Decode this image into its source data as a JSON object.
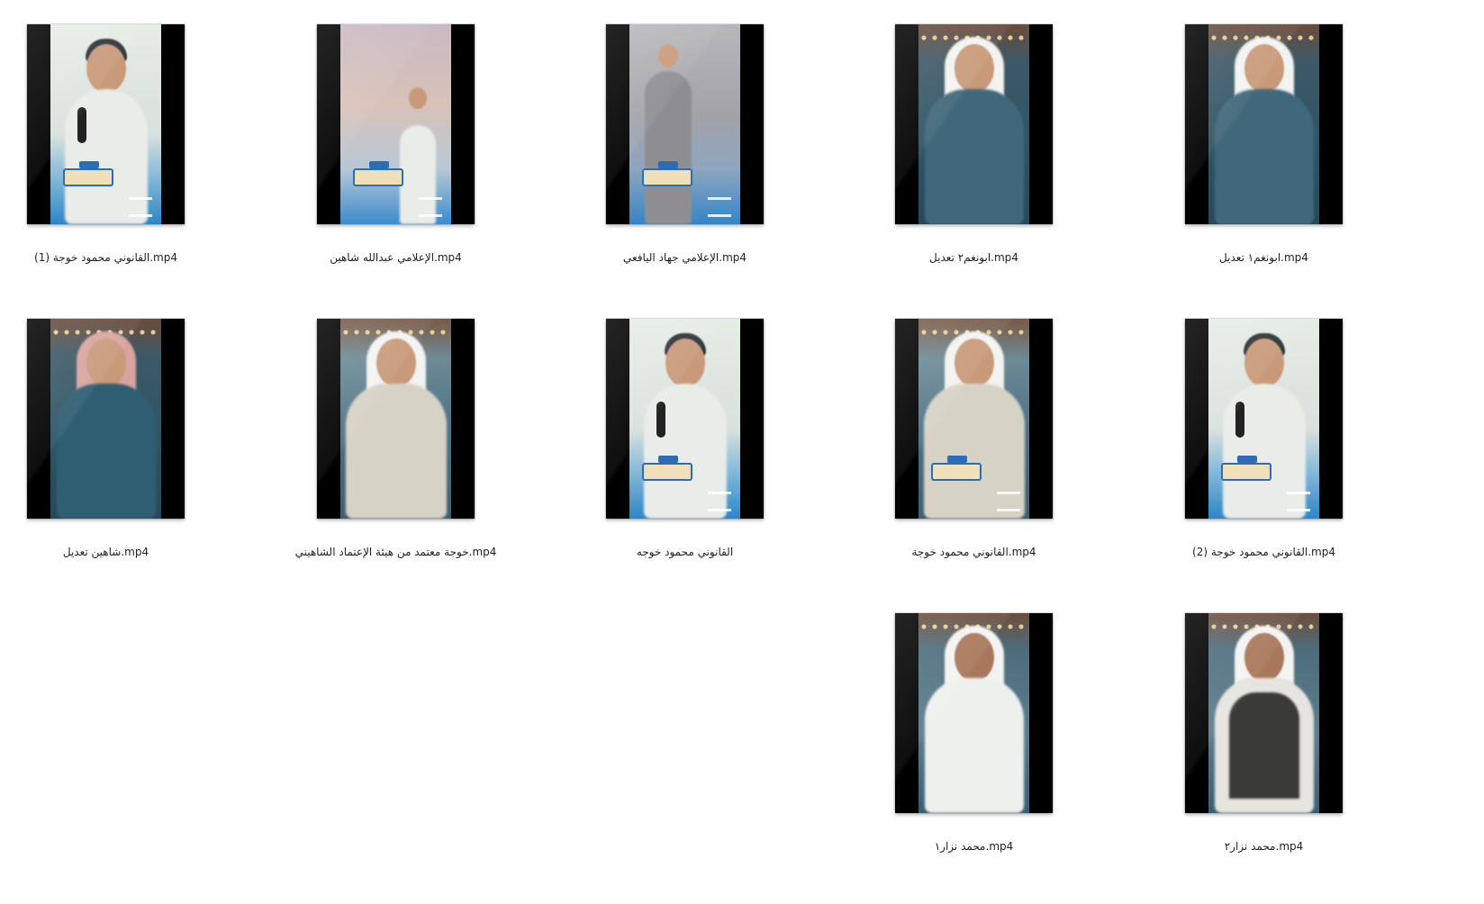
{
  "files": [
    {
      "name": "القانوني محمود خوجة (1).mp4",
      "thumbnail": "video-thumbnail",
      "scene": "promo"
    },
    {
      "name": "الإعلامي عبدالله شاهين.mp4",
      "thumbnail": "video-thumbnail",
      "scene": "studio"
    },
    {
      "name": "الإعلامي جهاد اليافعي.mp4",
      "thumbnail": "video-thumbnail",
      "scene": "room"
    },
    {
      "name": "ابونغم٢ تعديل.mp4",
      "thumbnail": "video-thumbnail",
      "scene": "stage"
    },
    {
      "name": "ابونغم١ تعديل.mp4",
      "thumbnail": "video-thumbnail",
      "scene": "stage"
    },
    {
      "name": "شاهين تعديل.mp4",
      "thumbnail": "video-thumbnail",
      "scene": "stage"
    },
    {
      "name": "خوجة معتمد من هيئة الإعتماد الشاهيني.mp4",
      "thumbnail": "video-thumbnail",
      "scene": "stage-light"
    },
    {
      "name": "القانوني محمود خوجه",
      "thumbnail": "video-thumbnail",
      "scene": "promo"
    },
    {
      "name": "القانوني محمود خوجة.mp4",
      "thumbnail": "video-thumbnail",
      "scene": "stage-light"
    },
    {
      "name": "القانوني محمود خوجة (2).mp4",
      "thumbnail": "video-thumbnail",
      "scene": "promo"
    },
    {
      "name": "محمد نزار١.mp4",
      "thumbnail": "video-thumbnail",
      "scene": "stage-blue"
    },
    {
      "name": "محمد نزار٢.mp4",
      "thumbnail": "video-thumbnail",
      "scene": "stage-blue"
    }
  ]
}
